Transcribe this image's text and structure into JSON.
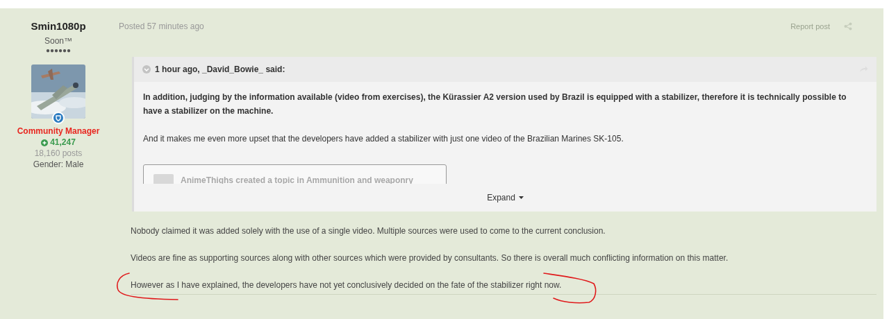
{
  "author": {
    "name": "Smin1080p",
    "title": "Soon™",
    "pips": "●●●●●●",
    "group": "Community Manager",
    "reputation": "41,247",
    "posts": "18,160 posts",
    "gender": "Gender: Male"
  },
  "post": {
    "posted": "Posted 57 minutes ago",
    "report": "Report post",
    "quote": {
      "header": "1 hour ago, _David_Bowie_ said:",
      "paragraphs": [
        {
          "bold": true,
          "text": "In addition, judging by the information available (video from exercises), the Kürassier A2 version used by Brazil is equipped with a stabilizer, therefore it is technically possible to have a stabilizer on the machine."
        },
        {
          "bold": false,
          "text": "And it makes me even more upset that the developers have added a stabilizer with just one video of the Brazilian Marines SK-105."
        }
      ],
      "embed": "AnimeThighs created a topic in Ammunition and weaponry",
      "expand": "Expand"
    },
    "paragraphs": [
      "Nobody claimed it was added solely with the use of a single video. Multiple sources were used to come to the current conclusion.",
      "Videos are fine as supporting sources along with other sources which were provided by consultants. So there is overall much conflicting information on this matter.",
      "However as I have explained, the developers have not yet conclusively decided on the fate of the stabilizer right now."
    ]
  },
  "annotations": {
    "marker_strokes": [
      {
        "color": "#e0191b"
      },
      {
        "color": "#e0191b"
      }
    ]
  }
}
